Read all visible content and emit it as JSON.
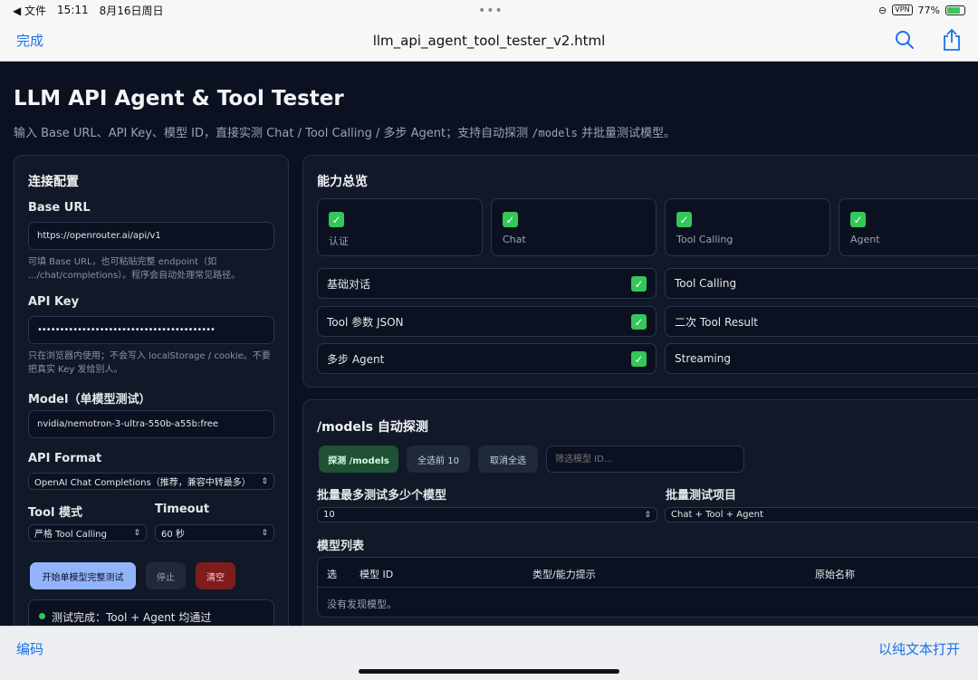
{
  "status": {
    "back": "◀ 文件",
    "time": "15:11",
    "date": "8月16日周日",
    "vpn": "VPN",
    "battery": "77%",
    "battery_level": 0.77
  },
  "nav": {
    "done": "完成",
    "title": "llm_api_agent_tool_tester_v2.html"
  },
  "page": {
    "title": "LLM API Agent & Tool Tester",
    "subtitle_pre": "输入 Base URL、API Key、模型 ID，直接实测 Chat / Tool Calling / 多步 Agent；支持自动探测 ",
    "subtitle_code": "/models",
    "subtitle_post": " 并批量测试模型。"
  },
  "config": {
    "heading": "连接配置",
    "base_url_label": "Base URL",
    "base_url_value": "https://openrouter.ai/api/v1",
    "base_url_hint": "可填 Base URL，也可粘贴完整 endpoint（如 .../chat/completions）。程序会自动处理常见路径。",
    "api_key_label": "API Key",
    "api_key_value": "••••••••••••••••••••••••••••••••••••••••",
    "api_key_hint": "只在浏览器内使用；不会写入 localStorage / cookie。不要把真实 Key 发给别人。",
    "model_label": "Model（单模型测试）",
    "model_value": "nvidia/nemotron-3-ultra-550b-a55b:free",
    "format_label": "API Format",
    "format_value": "OpenAI Chat Completions（推荐，兼容中转最多）",
    "tool_mode_label": "Tool 模式",
    "tool_mode_value": "严格 Tool Calling",
    "timeout_label": "Timeout",
    "timeout_value": "60 秒",
    "start_button": "开始单模型完整测试",
    "stop_button": "停止",
    "clear_button": "清空",
    "result_text": "测试完成：Tool + Agent 均通过"
  },
  "capabilities": {
    "heading": "能力总览",
    "tiles": [
      "认证",
      "Chat",
      "Tool Calling",
      "Agent"
    ],
    "rows_left": [
      "基础对话",
      "Tool 参数 JSON",
      "多步 Agent"
    ],
    "rows_right": [
      "Tool Calling",
      "二次 Tool Result",
      "Streaming"
    ]
  },
  "models": {
    "heading": "/models 自动探测",
    "probe_button": "探测 /models",
    "select_top_button": "全选前 10",
    "deselect_button": "取消全选",
    "filter_placeholder": "筛选模型 ID...",
    "batch_max_label": "批量最多测试多少个模型",
    "batch_max_value": "10",
    "batch_items_label": "批量测试项目",
    "batch_items_value": "Chat + Tool + Agent",
    "list_label": "模型列表",
    "columns": [
      "选",
      "模型 ID",
      "类型/能力提示",
      "原始名称"
    ],
    "empty_text": "没有发现模型。"
  },
  "toolbar": {
    "encoding": "编码",
    "open_plain": "以纯文本打开"
  }
}
